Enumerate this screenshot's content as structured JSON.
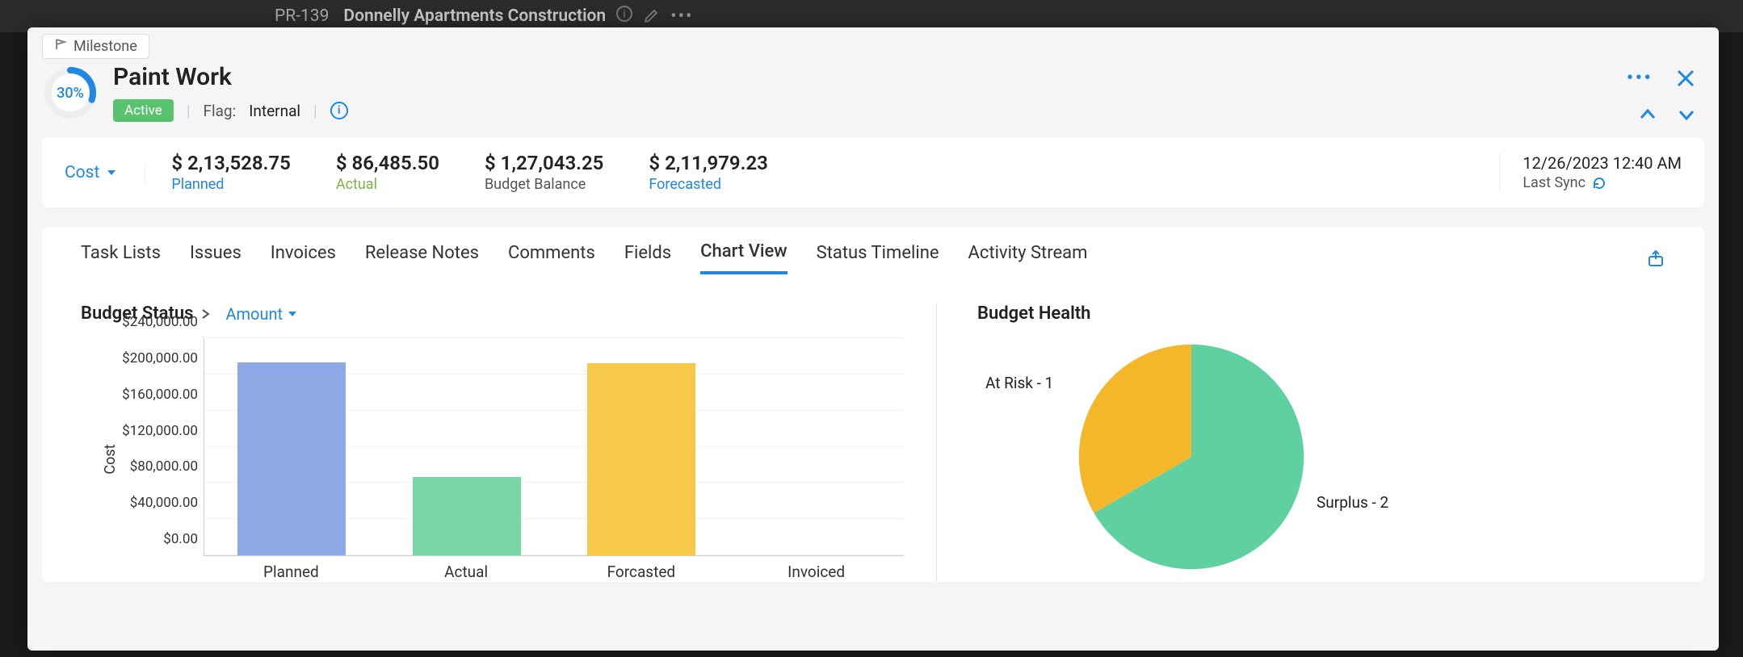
{
  "header": {
    "project_id": "PR-139",
    "project_title": "Donnelly Apartments Construction"
  },
  "milestone_chip": "Milestone",
  "title": "Paint Work",
  "progress_pct": "30%",
  "progress_fraction": 0.3,
  "status_badge": "Active",
  "flag_label": "Flag:",
  "flag_value": "Internal",
  "cost_selector_label": "Cost",
  "metrics": {
    "planned": {
      "value": "$ 2,13,528.75",
      "label": "Planned"
    },
    "actual": {
      "value": "$ 86,485.50",
      "label": "Actual"
    },
    "balance": {
      "value": "$ 1,27,043.25",
      "label": "Budget Balance"
    },
    "forecast": {
      "value": "$ 2,11,979.23",
      "label": "Forecasted"
    }
  },
  "sync": {
    "timestamp": "12/26/2023 12:40 AM",
    "label": "Last Sync"
  },
  "tabs": [
    "Task Lists",
    "Issues",
    "Invoices",
    "Release Notes",
    "Comments",
    "Fields",
    "Chart View",
    "Status Timeline",
    "Activity Stream"
  ],
  "active_tab": "Chart View",
  "chart_titles": {
    "budget_status": "Budget Status",
    "amount": "Amount",
    "budget_health": "Budget Health"
  },
  "chart_data": [
    {
      "type": "bar",
      "title": "Budget Status",
      "ylabel": "Cost",
      "categories": [
        "Planned",
        "Actual",
        "Forcasted",
        "Invoiced"
      ],
      "values": [
        213528.75,
        86485.5,
        211979.23,
        0
      ],
      "colors": [
        "#8fa9e6",
        "#79d6a7",
        "#f7c948",
        "#ccc"
      ],
      "yticks": [
        "$0.00",
        "$40,000.00",
        "$80,000.00",
        "$120,000.00",
        "$160,000.00",
        "$200,000.00",
        "$240,000.00"
      ],
      "ylim": [
        0,
        240000
      ]
    },
    {
      "type": "pie",
      "title": "Budget Health",
      "series": [
        {
          "name": "At Risk",
          "value": 1,
          "color": "#f5b72a",
          "label": "At Risk - 1"
        },
        {
          "name": "Surplus",
          "value": 2,
          "color": "#5fd0a0",
          "label": "Surplus - 2"
        }
      ]
    }
  ]
}
